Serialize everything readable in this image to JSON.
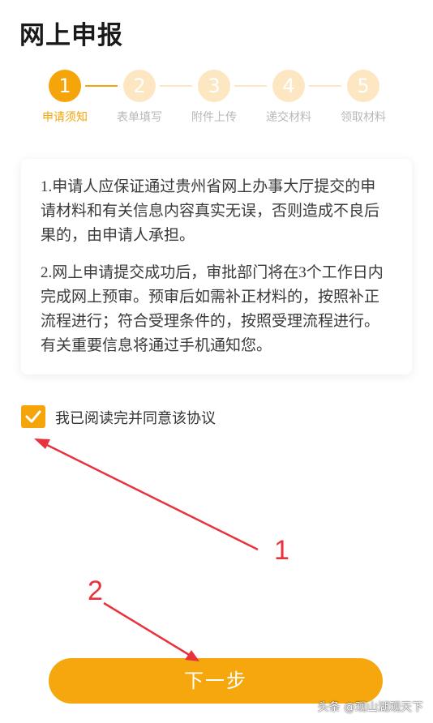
{
  "page": {
    "title": "网上申报"
  },
  "stepper": {
    "steps": [
      {
        "num": "1",
        "label": "申请须知",
        "active": true
      },
      {
        "num": "2",
        "label": "表单填写",
        "active": false
      },
      {
        "num": "3",
        "label": "附件上传",
        "active": false
      },
      {
        "num": "4",
        "label": "递交材料",
        "active": false
      },
      {
        "num": "5",
        "label": "领取材料",
        "active": false
      }
    ]
  },
  "notice": {
    "para1": "1.申请人应保证通过贵州省网上办事大厅提交的申请材料和有关信息内容真实无误，否则造成不良后果的，由申请人承担。",
    "para2": "2.网上申请提交成功后，审批部门将在3个工作日内完成网上预审。预审后如需补正材料的，按照补正流程进行；符合受理条件的，按照受理流程进行。有关重要信息将通过手机通知您。"
  },
  "agreement": {
    "checked": true,
    "label": "我已阅读完并同意该协议"
  },
  "actions": {
    "next_label": "下一步"
  },
  "annotations": {
    "num1": "1",
    "num2": "2"
  },
  "watermark": "头条 @观山湖观天下",
  "colors": {
    "accent": "#f5a50a",
    "accent_light": "#fde7c3",
    "annotation": "#e8323c"
  }
}
